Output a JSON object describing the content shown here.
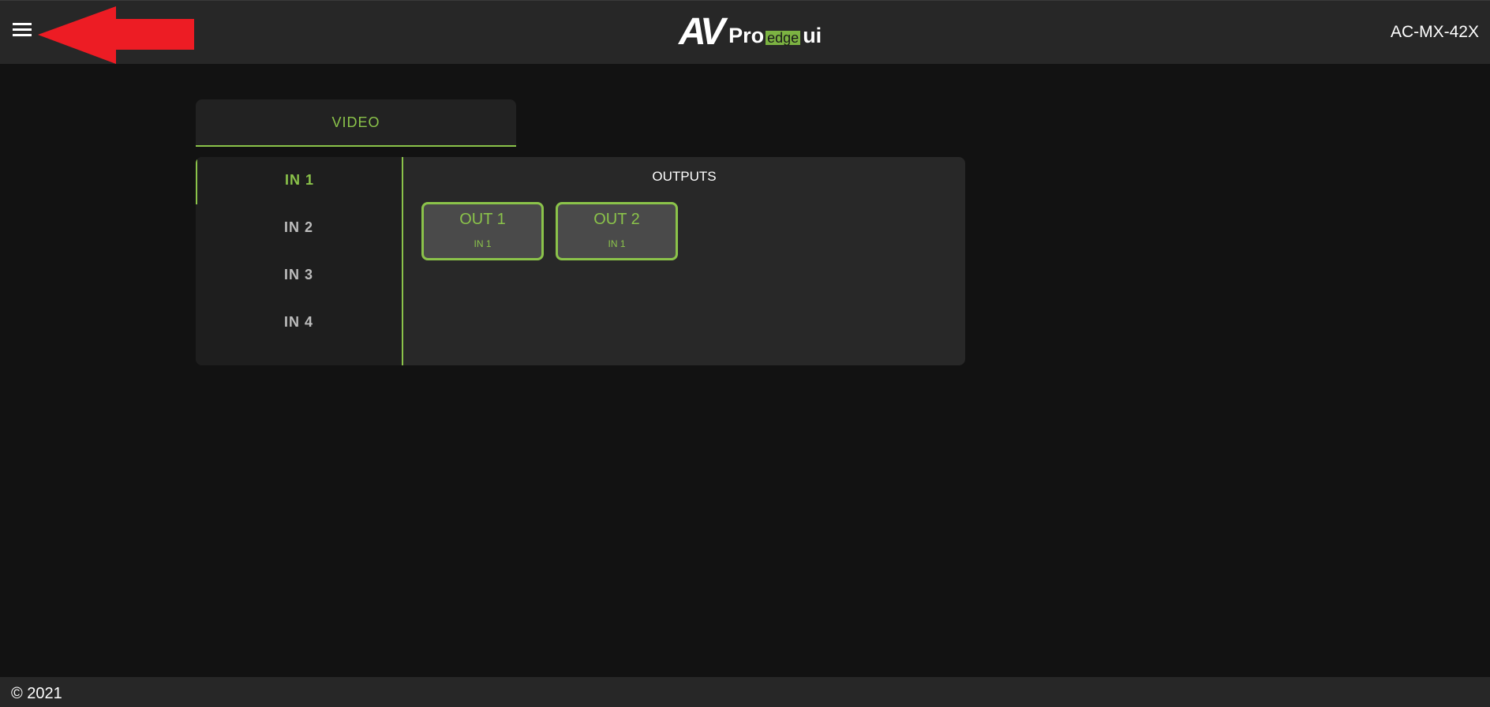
{
  "header": {
    "menu_icon": "hamburger-menu-icon",
    "logo": {
      "av": "AV",
      "pro": "Pro",
      "edge": "edge",
      "ui": "ui"
    },
    "device_name": "AC-MX-42X",
    "annotation_color": "#ed1c24"
  },
  "tabs": [
    {
      "label": "VIDEO",
      "active": true
    }
  ],
  "inputs": [
    {
      "label": "IN 1",
      "active": true
    },
    {
      "label": "IN 2",
      "active": false
    },
    {
      "label": "IN 3",
      "active": false
    },
    {
      "label": "IN 4",
      "active": false
    }
  ],
  "outputs": {
    "title": "OUTPUTS",
    "items": [
      {
        "name": "OUT 1",
        "source": "IN 1"
      },
      {
        "name": "OUT 2",
        "source": "IN 1"
      }
    ]
  },
  "footer": {
    "copyright": "© 2021"
  },
  "colors": {
    "accent": "#8bc34a",
    "header_bg": "#272727",
    "page_bg": "#121212"
  }
}
